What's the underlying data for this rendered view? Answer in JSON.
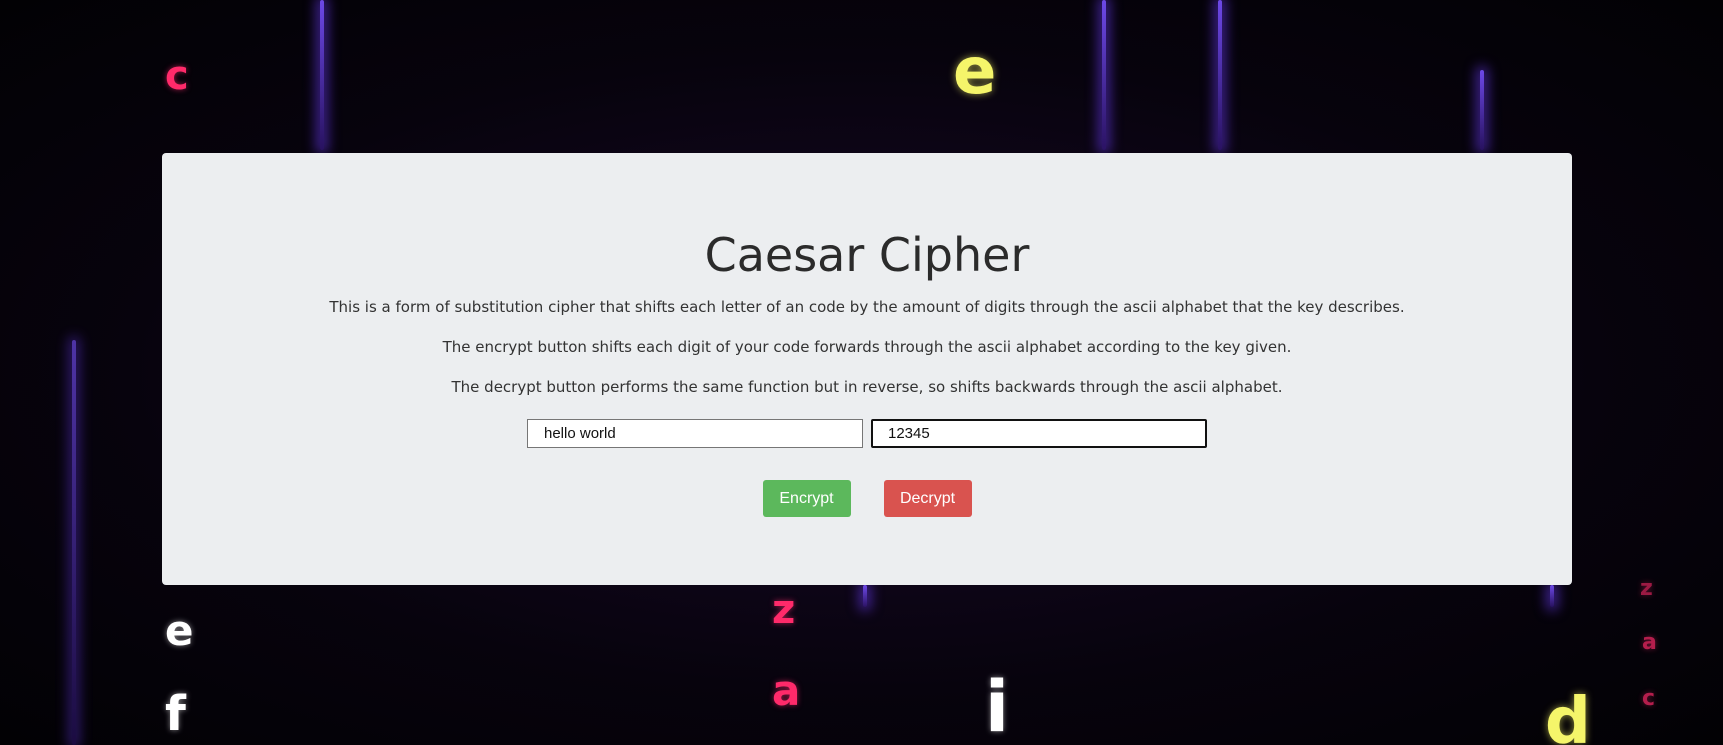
{
  "page": {
    "title": "Caesar Cipher",
    "descriptions": [
      "This is a form of substitution cipher that shifts each letter of an code by the amount of digits through the ascii alphabet that the key describes.",
      "The encrypt button shifts each digit of your code forwards through the ascii alphabet according to the key given.",
      "The decrypt button performs the same function but in reverse, so shifts backwards through the ascii alphabet."
    ]
  },
  "form": {
    "code_value": "hello world",
    "key_value": "12345",
    "encrypt_label": "Encrypt",
    "decrypt_label": "Decrypt"
  },
  "background": {
    "letters": [
      "c",
      "e",
      "z",
      "a",
      "e",
      "f",
      "i",
      "d",
      "z",
      "a",
      "c"
    ]
  },
  "colors": {
    "card_bg": "#eceef0",
    "encrypt": "#5cb85c",
    "decrypt": "#d9534f",
    "beam": "#7850ff"
  }
}
